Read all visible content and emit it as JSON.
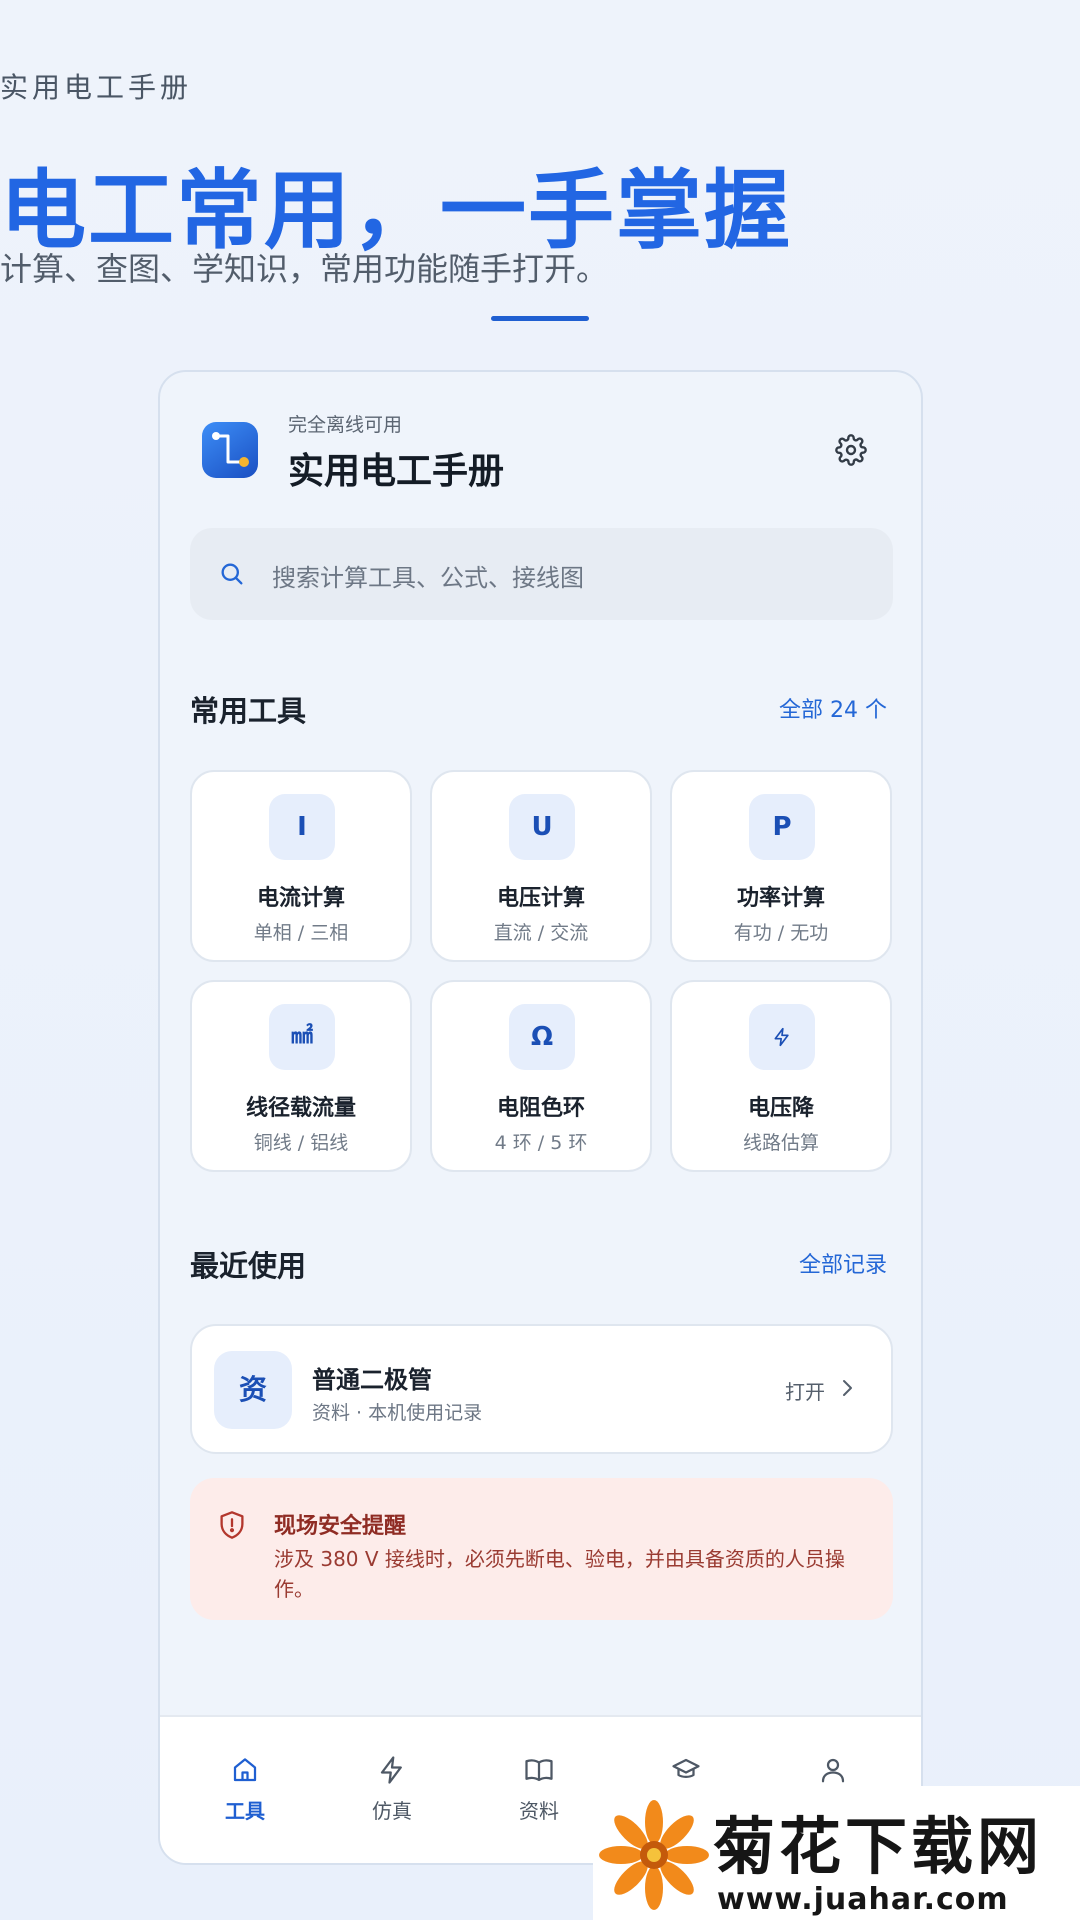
{
  "hero": {
    "eyebrow": "实用电工手册",
    "title": "电工常用，一手掌握",
    "subtitle": "计算、查图、学知识，常用功能随手打开。"
  },
  "header": {
    "offline_label": "完全离线可用",
    "app_title": "实用电工手册",
    "settings_icon": "gear-icon"
  },
  "search": {
    "placeholder": "搜索计算工具、公式、接线图"
  },
  "tools_section": {
    "title": "常用工具",
    "all_link": "全部 24 个",
    "items": [
      {
        "icon": "I",
        "name": "电流计算",
        "desc": "单相 / 三相"
      },
      {
        "icon": "U",
        "name": "电压计算",
        "desc": "直流 / 交流"
      },
      {
        "icon": "P",
        "name": "功率计算",
        "desc": "有功 / 无功"
      },
      {
        "icon": "㎟",
        "name": "线径载流量",
        "desc": "铜线 / 铝线"
      },
      {
        "icon": "Ω",
        "name": "电阻色环",
        "desc": "4 环 / 5 环"
      },
      {
        "icon": "lightning-icon",
        "name": "电压降",
        "desc": "线路估算"
      }
    ]
  },
  "recent_section": {
    "title": "最近使用",
    "all_link": "全部记录",
    "items": [
      {
        "icon": "资",
        "title": "普通二极管",
        "subtitle": "资料 · 本机使用记录",
        "action": "打开"
      }
    ]
  },
  "alert": {
    "title": "现场安全提醒",
    "text": "涉及 380 V 接线时，必须先断电、验电，并由具备资质的人员操作。"
  },
  "tabbar": {
    "tabs": [
      {
        "label": "工具",
        "icon": "home-icon",
        "active": true
      },
      {
        "label": "仿真",
        "icon": "lightning-icon",
        "active": false
      },
      {
        "label": "资料",
        "icon": "book-icon",
        "active": false
      },
      {
        "label": "",
        "icon": "graduation-cap-icon",
        "active": false
      },
      {
        "label": "",
        "icon": "user-icon",
        "active": false
      }
    ]
  },
  "watermark": {
    "text": "菊花下载网",
    "url": "www.juahar.com"
  },
  "colors": {
    "accent": "#2266e3",
    "alert_bg": "#fdecea",
    "alert_text": "#9a3b32"
  }
}
